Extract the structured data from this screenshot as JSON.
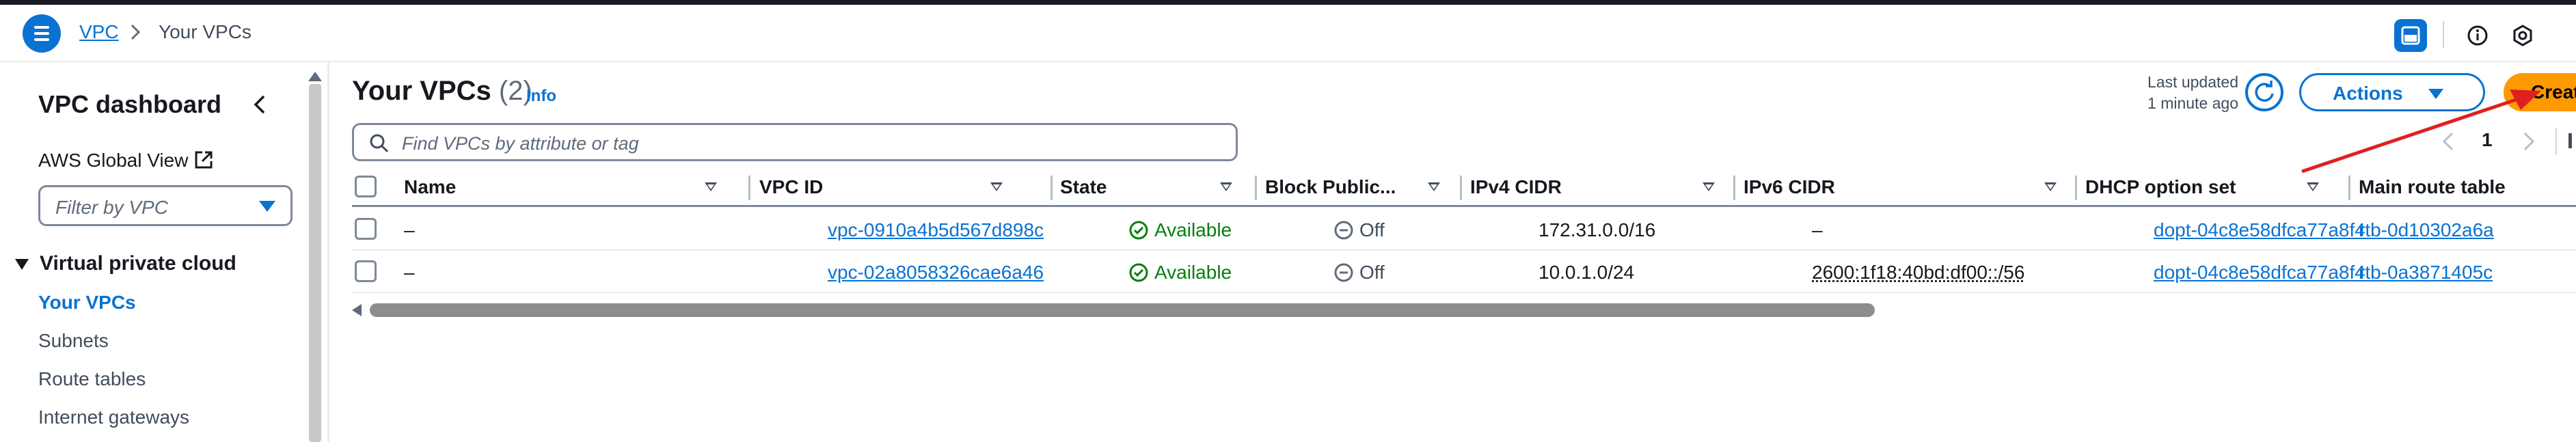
{
  "header": {
    "breadcrumb": {
      "service": "VPC",
      "current": "Your VPCs"
    },
    "icons": [
      "menu-icon",
      "chevron-right-icon",
      "panel-icon",
      "info-icon",
      "settings-icon"
    ]
  },
  "sidebar": {
    "title": "VPC dashboard",
    "global_view": "AWS Global View",
    "filter_placeholder": "Filter by VPC",
    "section": "Virtual private cloud",
    "items": [
      {
        "label": "Your VPCs",
        "active": true
      },
      {
        "label": "Subnets"
      },
      {
        "label": "Route tables"
      },
      {
        "label": "Internet gateways"
      }
    ]
  },
  "main": {
    "title": "Your VPCs",
    "count": "(2)",
    "info": "Info",
    "last_updated_line1": "Last updated",
    "last_updated_line2": "1 minute ago",
    "actions_label": "Actions",
    "create_label": "Create VPC",
    "search_placeholder": "Find VPCs by attribute or tag",
    "page": "1",
    "columns": [
      "Name",
      "VPC ID",
      "State",
      "Block Public...",
      "IPv4 CIDR",
      "IPv6 CIDR",
      "DHCP option set",
      "Main route table"
    ],
    "rows": [
      {
        "name": "–",
        "vpc_id": "vpc-0910a4b5d567d898c",
        "state": "Available",
        "block": "Off",
        "ipv4": "172.31.0.0/16",
        "ipv6": "–",
        "dhcp": "dopt-04c8e58dfca77a8f4",
        "route": "rtb-0d10302a6a"
      },
      {
        "name": "–",
        "vpc_id": "vpc-02a8058326cae6a46",
        "state": "Available",
        "block": "Off",
        "ipv4": "10.0.1.0/24",
        "ipv6": "2600:1f18:40bd:df00::/56",
        "dhcp": "dopt-04c8e58dfca77a8f4",
        "route": "rtb-0a3871405c"
      }
    ]
  },
  "colors": {
    "accent": "#0972d3",
    "primary_button": "#ff9900",
    "success": "#037f0c",
    "annotation_arrow": "#e02020"
  }
}
